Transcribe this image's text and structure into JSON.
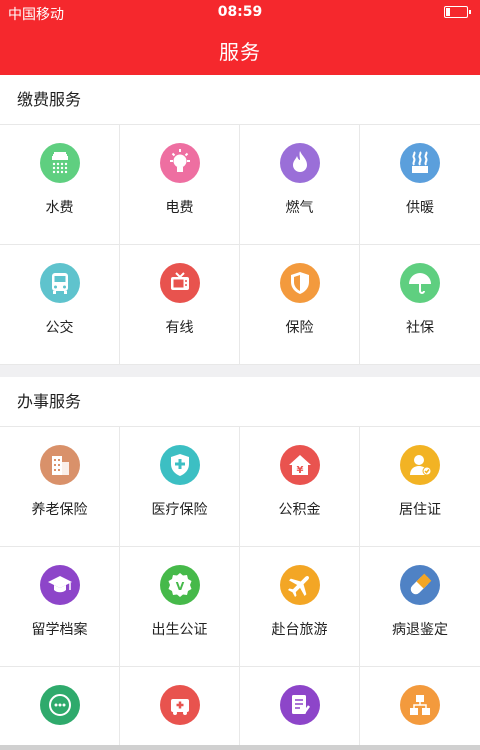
{
  "status_bar": {
    "carrier": "中国移动",
    "time": "08:59",
    "battery_percent": 20
  },
  "header": {
    "title": "服务"
  },
  "sections": [
    {
      "title": "缴费服务",
      "items": [
        {
          "label": "水费",
          "icon": "shower-icon",
          "color": "#5fcf80"
        },
        {
          "label": "电费",
          "icon": "lightbulb-icon",
          "color": "#ee6fa1"
        },
        {
          "label": "燃气",
          "icon": "flame-icon",
          "color": "#9a6fd8"
        },
        {
          "label": "供暖",
          "icon": "heating-icon",
          "color": "#5b9fdc"
        },
        {
          "label": "公交",
          "icon": "bus-icon",
          "color": "#5fc3cd"
        },
        {
          "label": "有线",
          "icon": "tv-icon",
          "color": "#e8534e"
        },
        {
          "label": "保险",
          "icon": "shield-icon",
          "color": "#f39a3d"
        },
        {
          "label": "社保",
          "icon": "umbrella-icon",
          "color": "#5fcf80"
        }
      ]
    },
    {
      "title": "办事服务",
      "items": [
        {
          "label": "养老保险",
          "icon": "building-icon",
          "color": "#d9916a"
        },
        {
          "label": "医疗保险",
          "icon": "medical-shield-icon",
          "color": "#3cbfc3"
        },
        {
          "label": "公积金",
          "icon": "housing-fund-icon",
          "color": "#e9534f"
        },
        {
          "label": "居住证",
          "icon": "resident-permit-icon",
          "color": "#f2b324"
        },
        {
          "label": "留学档案",
          "icon": "graduation-cap-icon",
          "color": "#8d45c9"
        },
        {
          "label": "出生公证",
          "icon": "certificate-icon",
          "color": "#46b94a"
        },
        {
          "label": "赴台旅游",
          "icon": "airplane-icon",
          "color": "#f3a625"
        },
        {
          "label": "病退鉴定",
          "icon": "pill-icon",
          "color": "#4f82c5"
        },
        {
          "label": "",
          "icon": "chat-icon",
          "color": "#2faa6c"
        },
        {
          "label": "",
          "icon": "ambulance-icon",
          "color": "#e8534e"
        },
        {
          "label": "",
          "icon": "document-icon",
          "color": "#8d45c9"
        },
        {
          "label": "",
          "icon": "network-icon",
          "color": "#f39a3d"
        }
      ]
    }
  ]
}
